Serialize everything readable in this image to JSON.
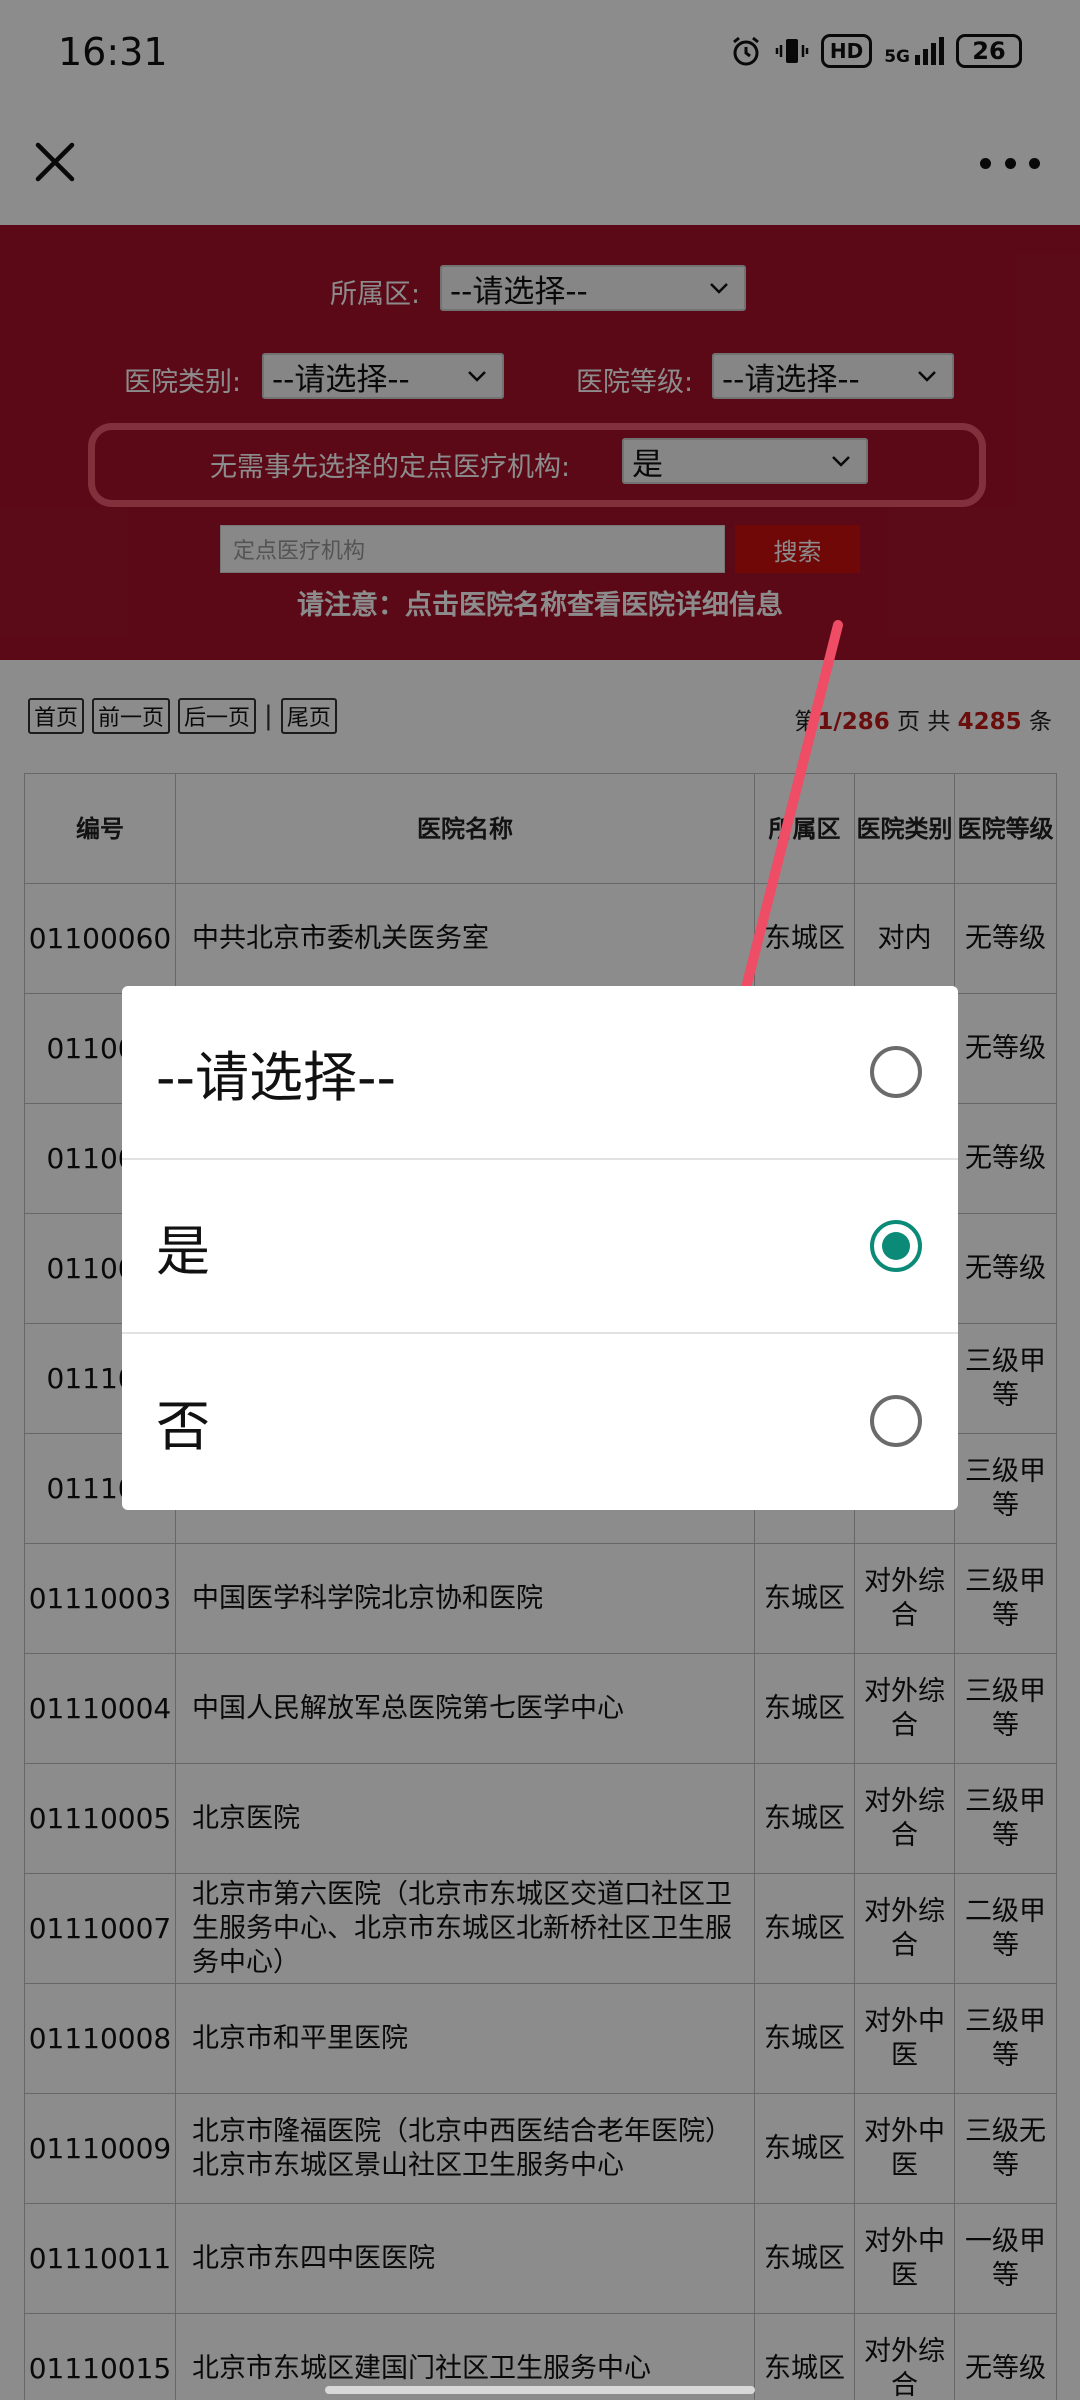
{
  "status_bar": {
    "time": "16:31",
    "network": "5G",
    "hd": "HD",
    "battery": "26"
  },
  "top_bar": {},
  "filters": {
    "district_label": "所属区:",
    "district_value": "--请选择--",
    "category_label": "医院类别:",
    "category_value": "--请选择--",
    "level_label": "医院等级:",
    "level_value": "--请选择--",
    "designated_label": "无需事先选择的定点医疗机构:",
    "designated_value": "是",
    "search_placeholder": "定点医疗机构",
    "search_button": "搜索",
    "note": "请注意：点击医院名称查看医院详细信息"
  },
  "pagination": {
    "first": "首页",
    "prev": "前一页",
    "next": "后一页",
    "sep": "|",
    "last": "尾页",
    "page_prefix": "第",
    "page_current": "1",
    "page_sep": "/",
    "page_total": "286",
    "page_suffix": "页 共",
    "total_count": "4285",
    "total_suffix": "条"
  },
  "table": {
    "headers": [
      "编号",
      "医院名称",
      "所属区",
      "医院类别",
      "医院等级"
    ],
    "rows": [
      [
        "01100060",
        "中共北京市委机关医务室",
        "东城区",
        "对内",
        "无等级"
      ],
      [
        "011000",
        "",
        "",
        "",
        "无等级"
      ],
      [
        "011000",
        "",
        "",
        "",
        "无等级"
      ],
      [
        "011000",
        "",
        "",
        "",
        "无等级"
      ],
      [
        "011100",
        "",
        "",
        "",
        "三级甲等"
      ],
      [
        "011100",
        "",
        "区",
        "综合",
        "三级甲等"
      ],
      [
        "01110003",
        "中国医学科学院北京协和医院",
        "东城区",
        "对外综合",
        "三级甲等"
      ],
      [
        "01110004",
        "中国人民解放军总医院第七医学中心",
        "东城区",
        "对外综合",
        "三级甲等"
      ],
      [
        "01110005",
        "北京医院",
        "东城区",
        "对外综合",
        "三级甲等"
      ],
      [
        "01110007",
        "北京市第六医院（北京市东城区交道口社区卫生服务中心、北京市东城区北新桥社区卫生服务中心）",
        "东城区",
        "对外综合",
        "二级甲等"
      ],
      [
        "01110008",
        "北京市和平里医院",
        "东城区",
        "对外中医",
        "三级甲等"
      ],
      [
        "01110009",
        "北京市隆福医院（北京中西医结合老年医院）北京市东城区景山社区卫生服务中心",
        "东城区",
        "对外中医",
        "三级无等"
      ],
      [
        "01110011",
        "北京市东四中医医院",
        "东城区",
        "对外中医",
        "一级甲等"
      ],
      [
        "01110015",
        "北京市东城区建国门社区卫生服务中心",
        "东城区",
        "对外综合",
        "无等级"
      ]
    ]
  },
  "dialog": {
    "options": [
      {
        "label": "--请选择--",
        "selected": false
      },
      {
        "label": "是",
        "selected": true
      },
      {
        "label": "否",
        "selected": false
      }
    ]
  },
  "colors": {
    "filter_bg": "#a6122b",
    "highlight": "#ef5870",
    "radio_selected": "#0b8a78",
    "search_btn": "#cc1010"
  }
}
